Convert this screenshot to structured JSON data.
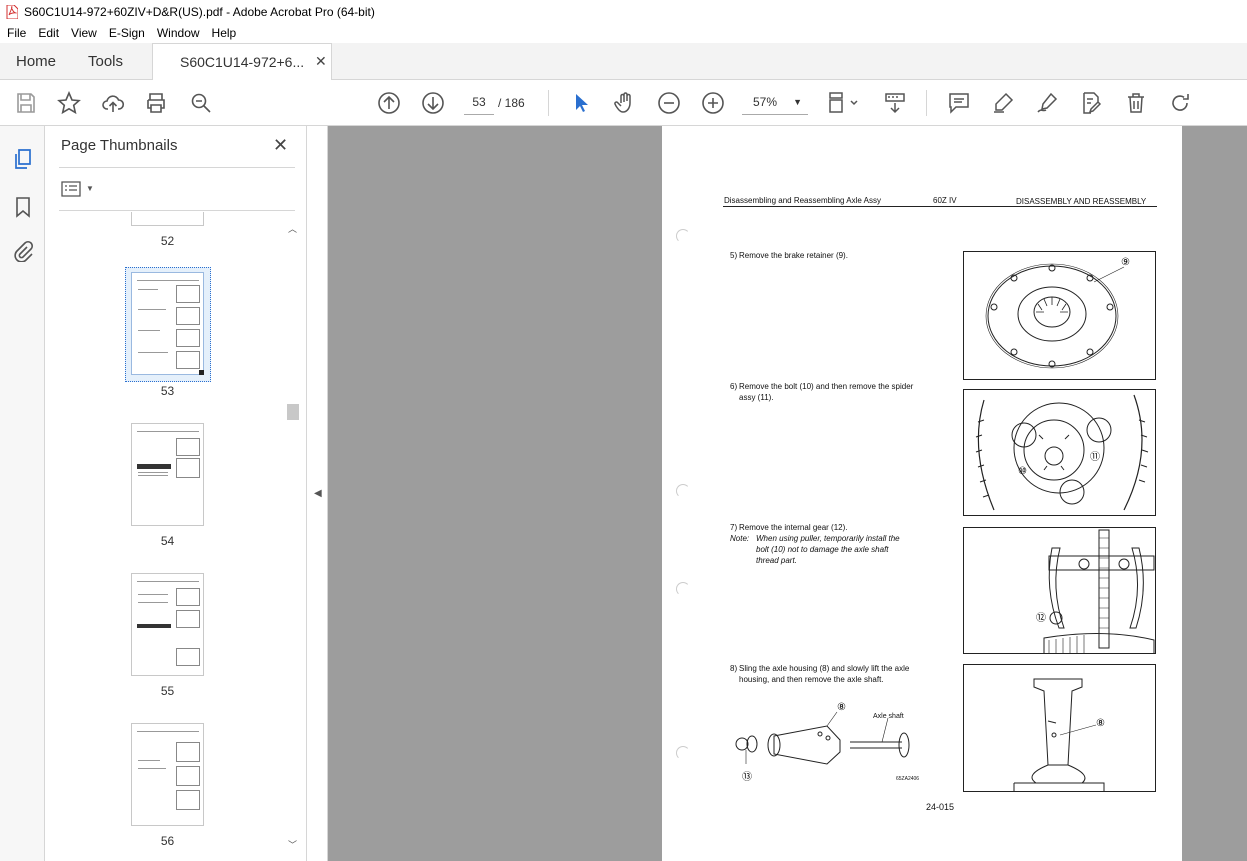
{
  "window": {
    "title": "S60C1U14-972+60ZIV+D&R(US).pdf - Adobe Acrobat Pro (64-bit)"
  },
  "menu": [
    "File",
    "Edit",
    "View",
    "E-Sign",
    "Window",
    "Help"
  ],
  "tabs": {
    "home": "Home",
    "tools": "Tools",
    "doc": "S60C1U14-972+6...",
    "close": "✕"
  },
  "toolbar": {
    "current_page": "53",
    "page_sep": "/ 186",
    "zoom": "57%",
    "zoom_caret": "▼",
    "icons": [
      "save-icon",
      "bookmark-star-icon",
      "upload-cloud-icon",
      "print-icon",
      "zoom-search-icon",
      "prev-page-icon",
      "next-page-icon",
      "select-cursor-icon",
      "hand-icon",
      "zoom-out-icon",
      "zoom-in-icon",
      "page-fit-icon",
      "scroll-mode-icon",
      "comment-icon",
      "highlight-icon",
      "sign-icon",
      "edit-pdf-icon",
      "delete-icon",
      "rotate-icon"
    ]
  },
  "thumbnails": {
    "title": "Page Thumbnails",
    "close": "✕",
    "options_caret": "▼",
    "pages": [
      "52",
      "53",
      "54",
      "55",
      "56"
    ],
    "selected": "53"
  },
  "document": {
    "header_left": "Disassembling and Reassembling Axle Assy",
    "header_mid": "60Z IV",
    "header_right": "DISASSEMBLY AND REASSEMBLY",
    "steps": [
      {
        "num": "5)",
        "text": "Remove the brake retainer (9)."
      },
      {
        "num": "6)",
        "text_line1": "Remove the bolt (10) and then remove the spider",
        "text_line2": "assy (11)."
      },
      {
        "num": "7)",
        "text": "Remove the internal gear (12)."
      },
      {
        "num": "8)",
        "text_line1": "Sling the axle housing (8) and slowly lift the axle",
        "text_line2": "housing, and then remove the axle shaft."
      }
    ],
    "note_label": "Note:",
    "note_line1": "When using puller, temporarily install the",
    "note_line2": "bolt  (10)  not to damage the axle shaft",
    "note_line3": "thread  part.",
    "callouts": {
      "fig1": "⑨",
      "fig2a": "⑩",
      "fig2b": "⑪",
      "fig3": "⑫",
      "fig4": "⑧",
      "sketch_8": "⑧",
      "sketch_13": "⑬"
    },
    "axle_shaft_label": "Axle shaft",
    "figure_code": "65ZA2406",
    "page_number": "24-015"
  }
}
